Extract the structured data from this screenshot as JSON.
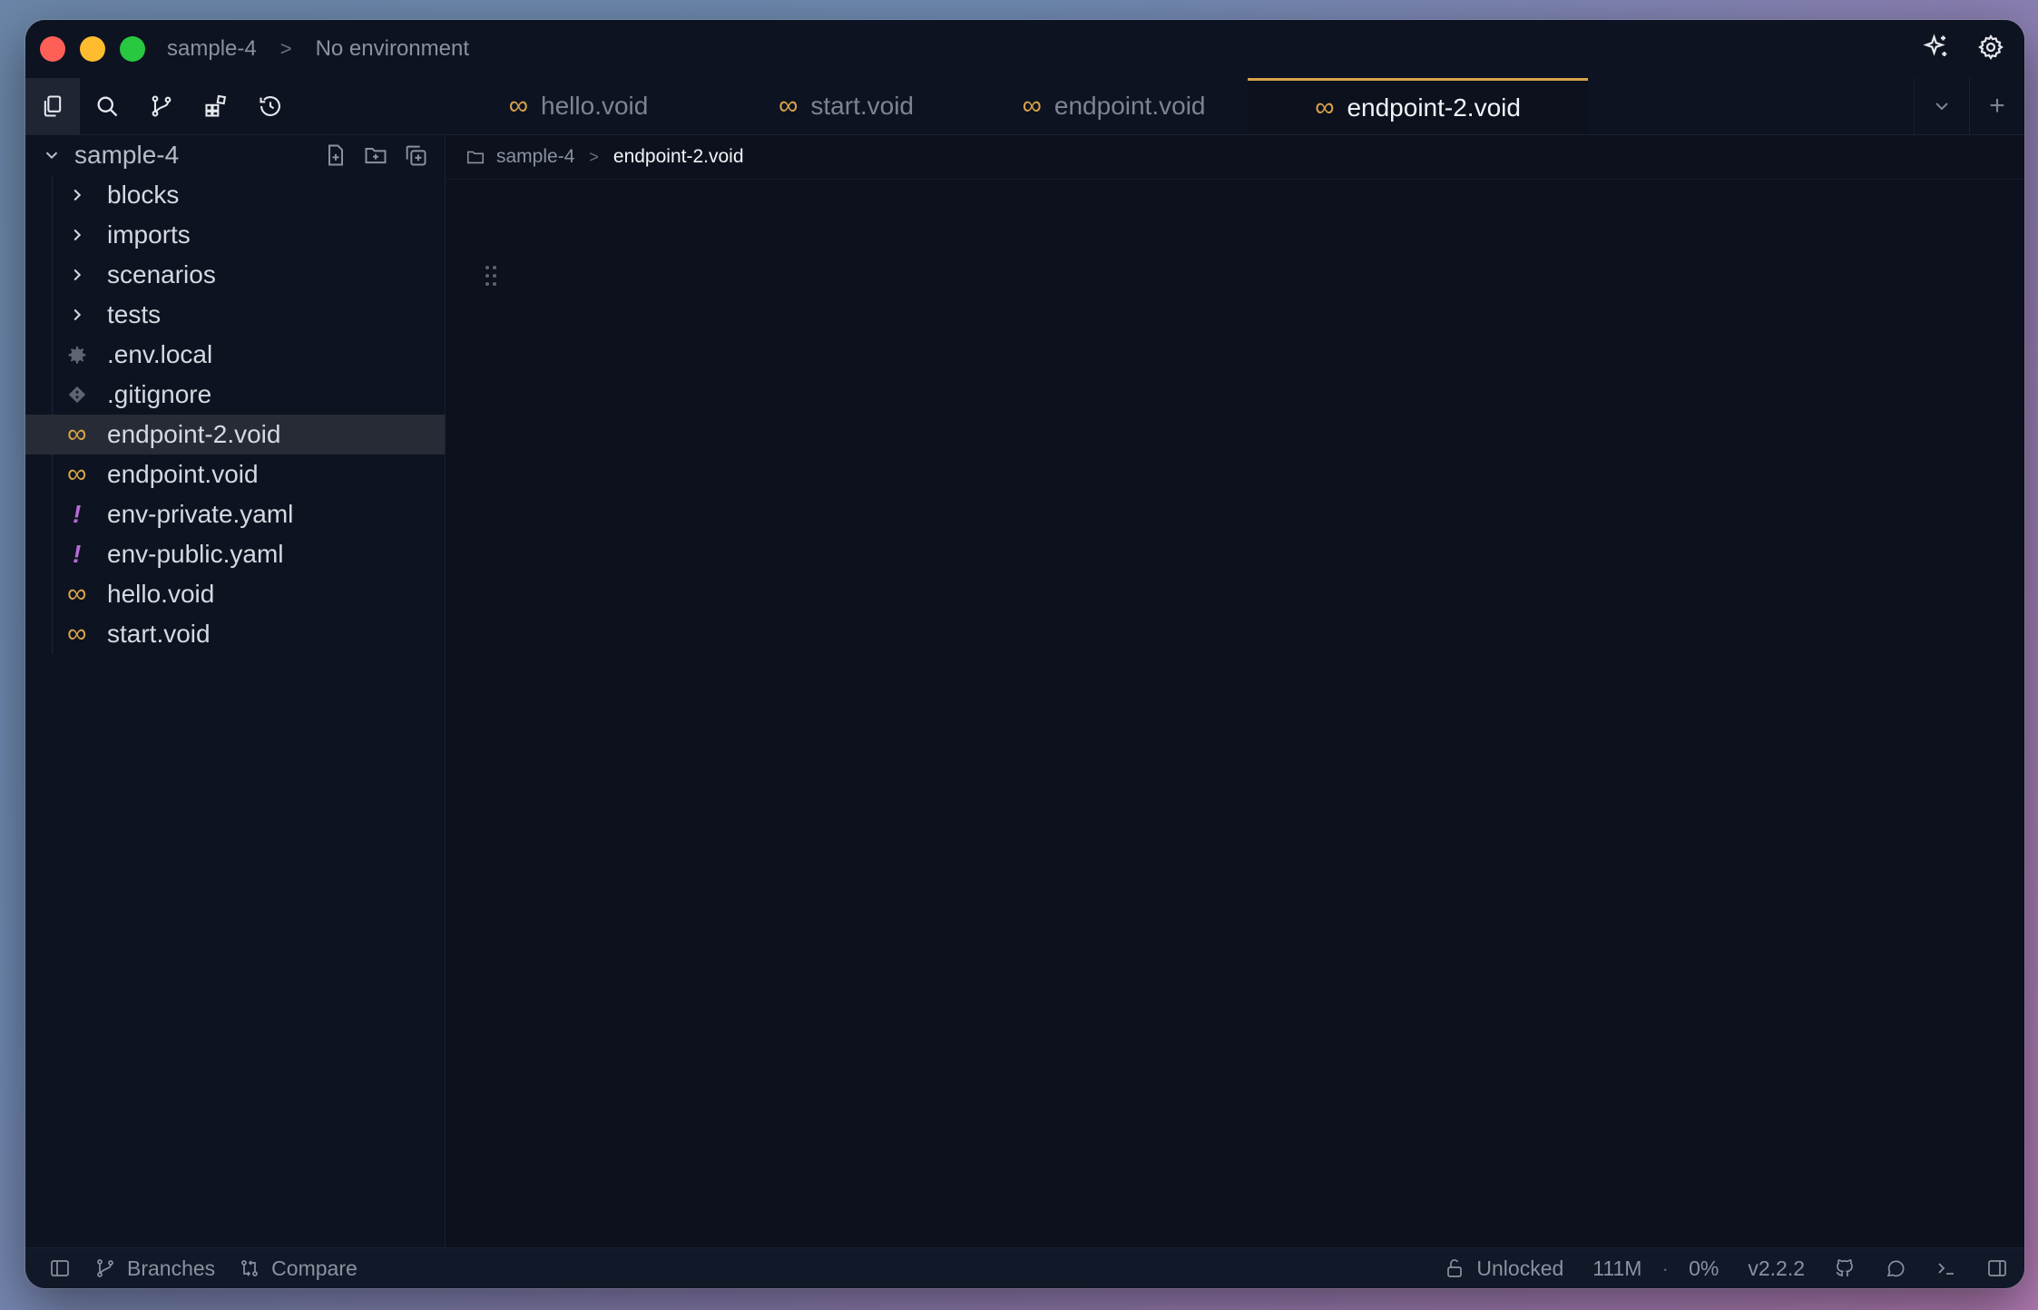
{
  "titlebar": {
    "project": "sample-4",
    "environment": "No environment"
  },
  "tabs": [
    {
      "label": "hello.void",
      "active": false
    },
    {
      "label": "start.void",
      "active": false
    },
    {
      "label": "endpoint.void",
      "active": false
    },
    {
      "label": "endpoint-2.void",
      "active": true
    }
  ],
  "tab_tools": {
    "add": "+"
  },
  "sidebar": {
    "project": "sample-4",
    "items": [
      {
        "label": "blocks",
        "type": "folder"
      },
      {
        "label": "imports",
        "type": "folder"
      },
      {
        "label": "scenarios",
        "type": "folder"
      },
      {
        "label": "tests",
        "type": "folder"
      },
      {
        "label": ".env.local",
        "type": "env"
      },
      {
        "label": ".gitignore",
        "type": "git"
      },
      {
        "label": "endpoint-2.void",
        "type": "void",
        "selected": true
      },
      {
        "label": "endpoint.void",
        "type": "void"
      },
      {
        "label": "env-private.yaml",
        "type": "yaml"
      },
      {
        "label": "env-public.yaml",
        "type": "yaml"
      },
      {
        "label": "hello.void",
        "type": "void"
      },
      {
        "label": "start.void",
        "type": "void"
      }
    ]
  },
  "breadcrumb": {
    "root": "sample-4",
    "current": "endpoint-2.void"
  },
  "statusbar": {
    "branches": "Branches",
    "compare": "Compare",
    "lock": "Unlocked",
    "memory": "111M",
    "cpu": "0%",
    "version": "v2.2.2"
  },
  "colors": {
    "accent": "#d9a24a",
    "yaml": "#b56bd6",
    "background": "#0c111d"
  }
}
